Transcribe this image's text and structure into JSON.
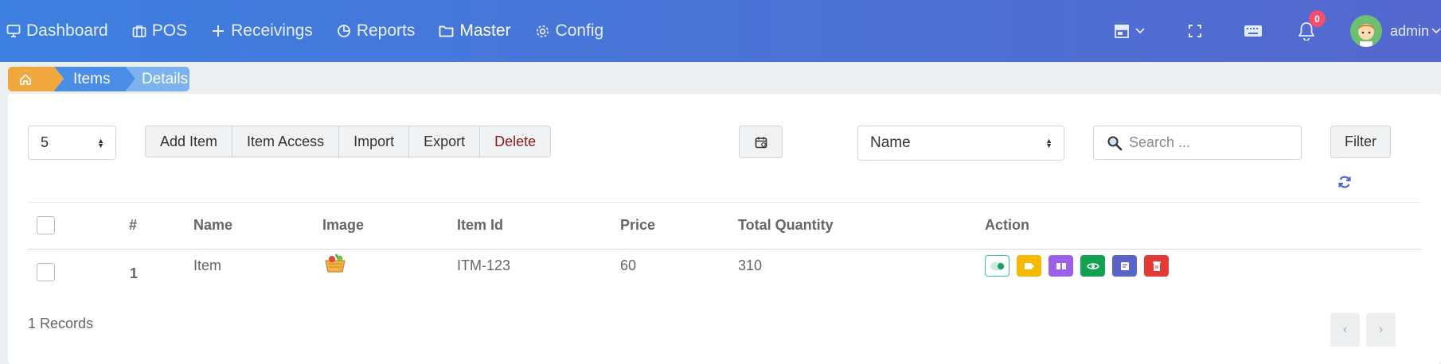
{
  "nav": {
    "items": [
      {
        "label": "Dashboard",
        "icon": "monitor-icon"
      },
      {
        "label": "POS",
        "icon": "briefcase-icon"
      },
      {
        "label": "Receivings",
        "icon": "plus-icon"
      },
      {
        "label": "Reports",
        "icon": "pie-chart-icon"
      },
      {
        "label": "Master",
        "icon": "folder-icon"
      },
      {
        "label": "Config",
        "icon": "gear-icon"
      }
    ],
    "active": "Master",
    "notification_count": "0",
    "user": "admin"
  },
  "breadcrumb": {
    "home_icon": "home-icon",
    "items": "Items",
    "details": "Details"
  },
  "toolbar": {
    "per_page": "5",
    "buttons": {
      "add_item": "Add Item",
      "item_access": "Item Access",
      "import": "Import",
      "export": "Export",
      "delete": "Delete"
    },
    "sort_by": "Name",
    "search_placeholder": "Search ...",
    "filter": "Filter"
  },
  "table": {
    "headers": {
      "num": "#",
      "name": "Name",
      "image": "Image",
      "item_id": "Item Id",
      "price": "Price",
      "total_quantity": "Total Quantity",
      "action": "Action"
    },
    "rows": [
      {
        "num": "1",
        "name": "Item",
        "image": "basket-image",
        "item_id": "ITM-123",
        "price": "60",
        "total_quantity": "310"
      }
    ],
    "action_icons": [
      "toggle-icon",
      "tag-icon",
      "barcode-icon",
      "eye-icon",
      "note-icon",
      "trash-icon"
    ],
    "action_colors": [
      "#ffffff",
      "#f6b800",
      "#9c5fe8",
      "#12a150",
      "#5b63c4",
      "#e53935"
    ]
  },
  "footer": {
    "records": "1 Records",
    "prev": "‹",
    "next": "›"
  }
}
